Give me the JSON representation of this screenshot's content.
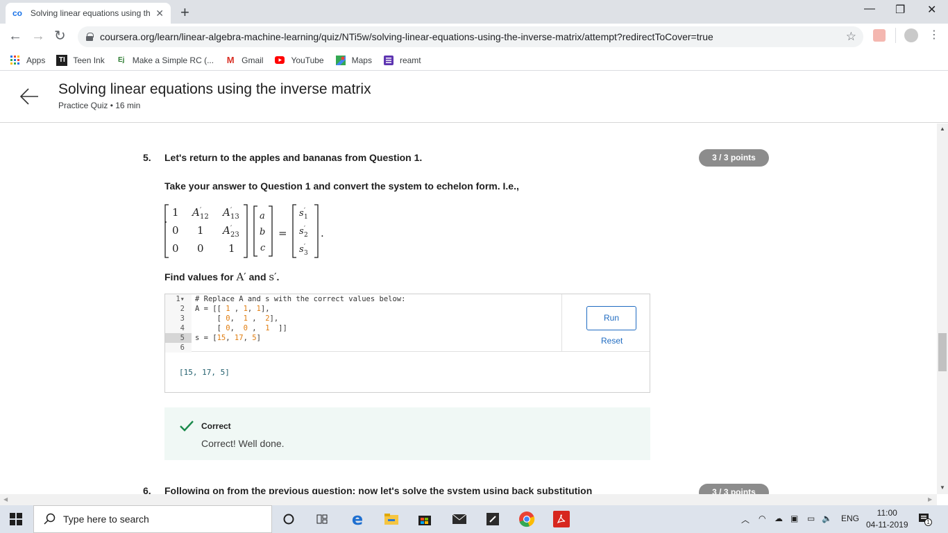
{
  "browser": {
    "tab_title": "Solving linear equations using th",
    "new_tab": "+",
    "url": "coursera.org/learn/linear-algebra-machine-learning/quiz/NTi5w/solving-linear-equations-using-the-inverse-matrix/attempt?redirectToCover=true"
  },
  "bookmarks": [
    {
      "label": "Apps"
    },
    {
      "label": "Teen Ink",
      "icon_text": "TI"
    },
    {
      "label": "Make a Simple RC (...",
      "icon_text": "Ej"
    },
    {
      "label": "Gmail",
      "icon_text": "M"
    },
    {
      "label": "YouTube"
    },
    {
      "label": "Maps"
    },
    {
      "label": "reamt"
    }
  ],
  "header": {
    "title": "Solving linear equations using the inverse matrix",
    "subtitle": "Practice Quiz • 16 min"
  },
  "question5": {
    "number": "5.",
    "text": "Let's return to the apples and bananas from Question 1.",
    "points": "3 / 3 points",
    "instruction": "Take your answer to Question 1 and convert the system to echelon form. I.e.,",
    "find_prefix": "Find values for ",
    "find_a": "A′",
    "find_and": " and ",
    "find_s": "s′",
    "find_suffix": "."
  },
  "editor": {
    "lines": [
      {
        "n": "1",
        "fold": "▾"
      },
      {
        "n": "2"
      },
      {
        "n": "3"
      },
      {
        "n": "4"
      },
      {
        "n": "5"
      },
      {
        "n": "6"
      }
    ],
    "code_line1": "# Replace A and s with the correct values below:",
    "run_label": "Run",
    "reset_label": "Reset",
    "output": "[15, 17, 5]"
  },
  "feedback": {
    "title": "Correct",
    "text": "Correct! Well done."
  },
  "question6": {
    "number": "6.",
    "text": "Following on from the previous question: now let's solve the system using back substitution",
    "points": "3 / 3 points"
  },
  "taskbar": {
    "search_placeholder": "Type here to search",
    "lang": "ENG",
    "time": "11:00",
    "date": "04-11-2019",
    "notification_count": "1"
  },
  "colors": {
    "accent": "#1f6bc1",
    "points_badge": "#8c8c8c",
    "correct_green": "#1a8a4b",
    "feedback_bg": "#f0f8f5"
  }
}
